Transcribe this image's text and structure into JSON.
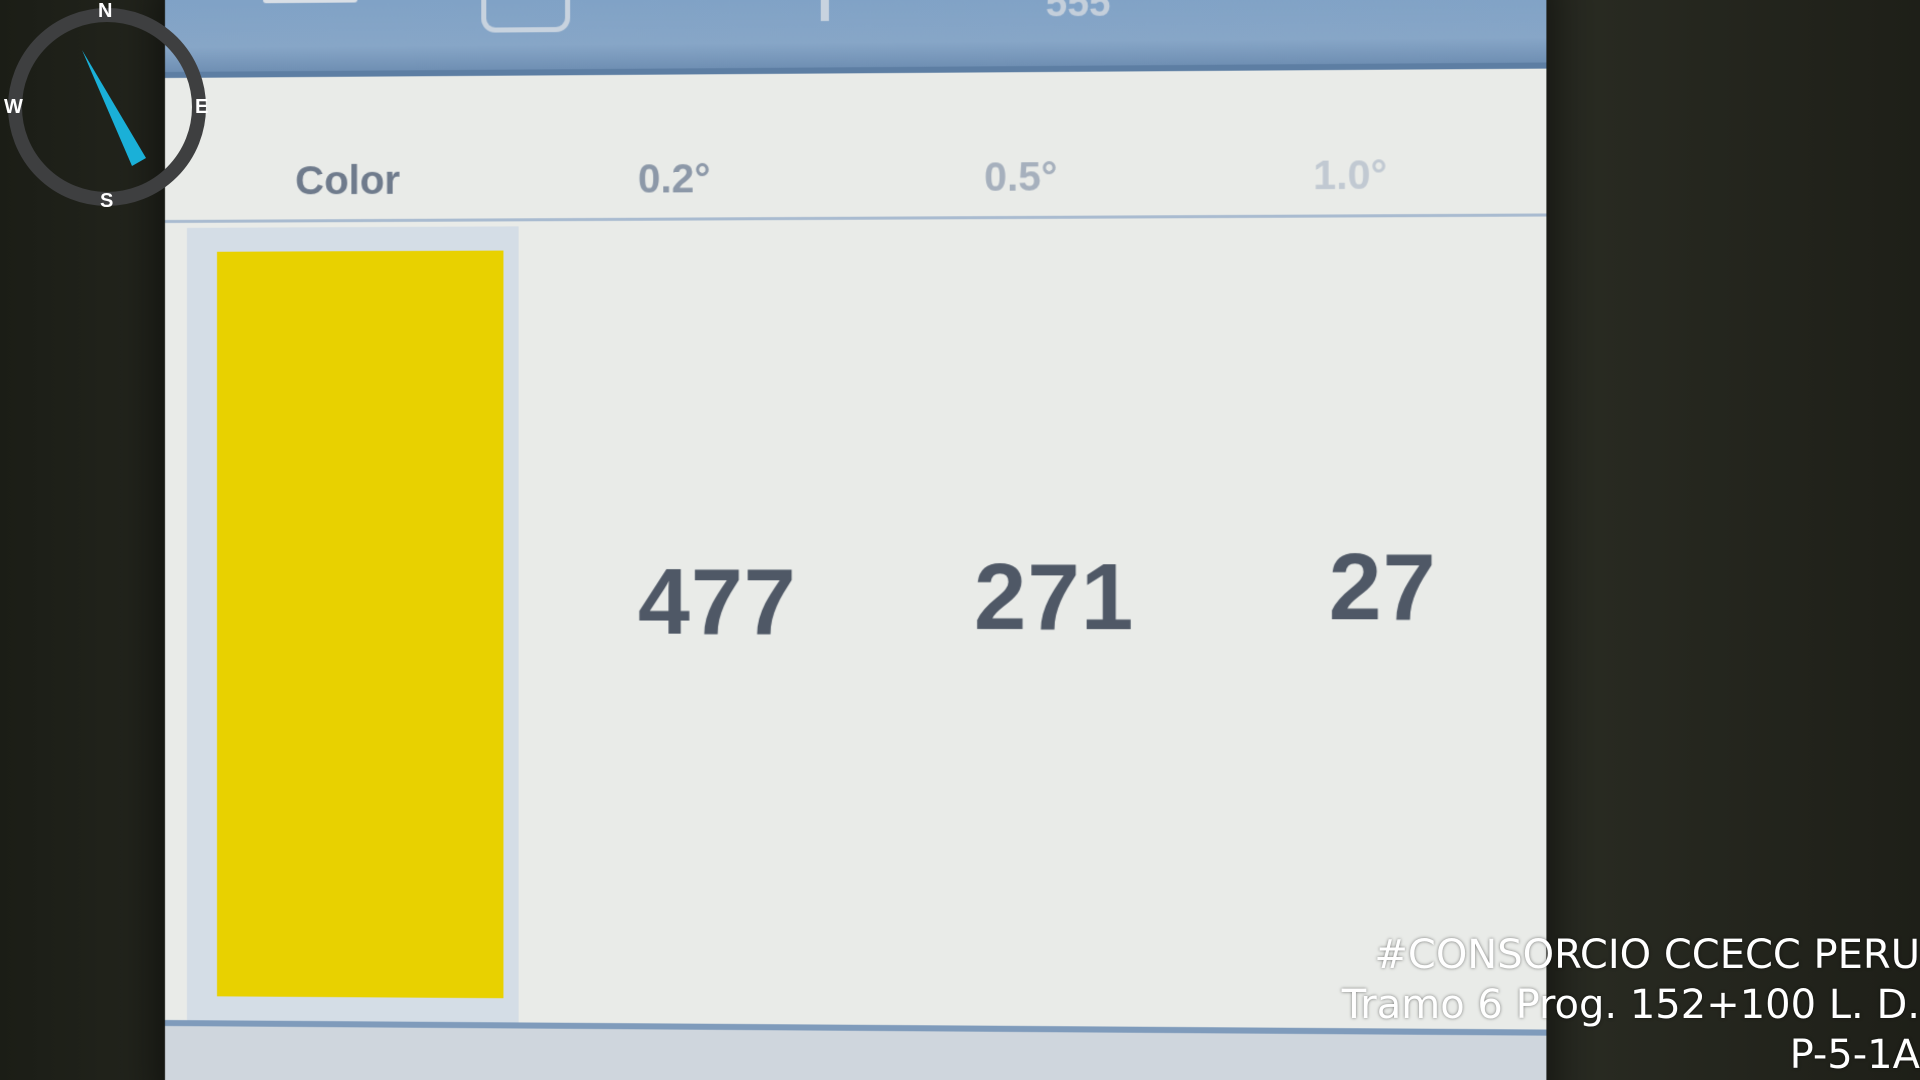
{
  "compass": {
    "north": "N",
    "south": "S",
    "west": "W",
    "east": "E",
    "needle_color": "#1ab0d8"
  },
  "topbar": {
    "partial_text": "555"
  },
  "table": {
    "headers": {
      "color": "Color",
      "angle_1": "0.2°",
      "angle_2": "0.5°",
      "angle_3": "1.0°"
    },
    "row": {
      "swatch_color": "#e8d100",
      "value_1": "477",
      "value_2": "271",
      "value_3": "27"
    }
  },
  "watermark": {
    "line1": "#CONSORCIO CCECC PERU",
    "line2": "Tramo 6 Prog. 152+100 L. D.",
    "line3": "P-5-1A"
  }
}
